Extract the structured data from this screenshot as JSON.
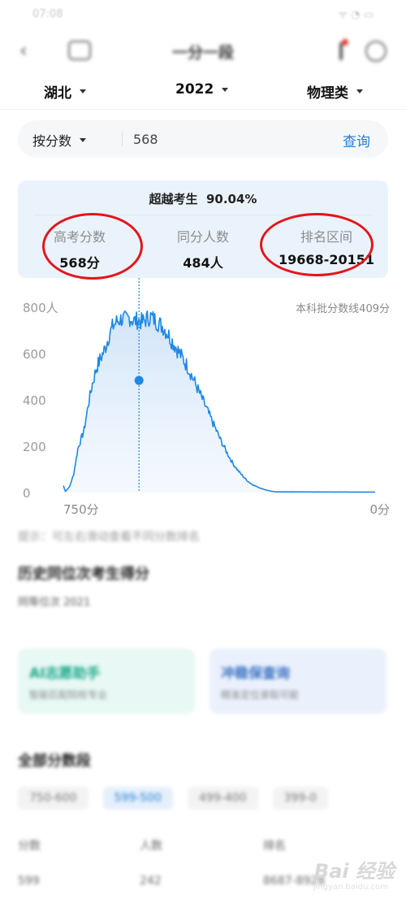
{
  "status_bar": {
    "time": "07:08",
    "right": "ᯤ ◔ ▭"
  },
  "nav": {
    "title": "一分一段"
  },
  "filters": {
    "province": "湖北",
    "year": "2022",
    "subject": "物理类"
  },
  "search": {
    "type": "按分数",
    "value": "568",
    "button": "查询"
  },
  "card": {
    "beat_label": "超越考生",
    "beat_value": "90.04%",
    "stats": [
      {
        "label": "高考分数",
        "value": "568分"
      },
      {
        "label": "同分人数",
        "value": "484人"
      },
      {
        "label": "排名区间",
        "value": "19668-20151"
      }
    ]
  },
  "chart_data": {
    "type": "area",
    "y_ticks": [
      "800人",
      "600",
      "400",
      "200",
      "0"
    ],
    "ylim": [
      0,
      800
    ],
    "x_left_label": "750分",
    "x_right_label": "0分",
    "xlim": [
      750,
      0
    ],
    "annotation": "本科批分数线409分",
    "marker": {
      "x": 568,
      "y": 484
    },
    "series": [
      {
        "color": "#1e88e5",
        "points": [
          [
            750,
            30
          ],
          [
            745,
            5
          ],
          [
            735,
            25
          ],
          [
            725,
            80
          ],
          [
            715,
            190
          ],
          [
            700,
            270
          ],
          [
            690,
            380
          ],
          [
            680,
            470
          ],
          [
            670,
            540
          ],
          [
            660,
            580
          ],
          [
            650,
            620
          ],
          [
            640,
            680
          ],
          [
            630,
            720
          ],
          [
            620,
            740
          ],
          [
            610,
            750
          ],
          [
            600,
            745
          ],
          [
            590,
            755
          ],
          [
            580,
            740
          ],
          [
            570,
            745
          ],
          [
            560,
            735
          ],
          [
            550,
            750
          ],
          [
            540,
            760
          ],
          [
            530,
            745
          ],
          [
            520,
            730
          ],
          [
            510,
            715
          ],
          [
            500,
            690
          ],
          [
            490,
            660
          ],
          [
            480,
            630
          ],
          [
            470,
            600
          ],
          [
            460,
            570
          ],
          [
            450,
            540
          ],
          [
            440,
            500
          ],
          [
            430,
            460
          ],
          [
            420,
            420
          ],
          [
            410,
            380
          ],
          [
            400,
            340
          ],
          [
            390,
            300
          ],
          [
            380,
            260
          ],
          [
            370,
            220
          ],
          [
            360,
            185
          ],
          [
            350,
            150
          ],
          [
            340,
            120
          ],
          [
            330,
            95
          ],
          [
            320,
            75
          ],
          [
            310,
            55
          ],
          [
            300,
            40
          ],
          [
            290,
            30
          ],
          [
            280,
            22
          ],
          [
            270,
            15
          ],
          [
            260,
            10
          ],
          [
            250,
            6
          ],
          [
            240,
            3
          ],
          [
            0,
            2
          ]
        ]
      }
    ],
    "grid": false
  },
  "footer": {
    "tip": "提示：可左右滑动查看不同分数排名",
    "history_title": "历史同位次考生得分",
    "history_sub": "同等位次 2021",
    "promo_left": {
      "title": "AI志愿助手",
      "sub": "智能匹配院校专业"
    },
    "promo_right": {
      "title": "冲稳保查询",
      "sub": "精准定位录取可能"
    },
    "table_title": "全部分数段",
    "chips": [
      "750-600",
      "599-500",
      "499-400",
      "399-0"
    ],
    "table": [
      {
        "c1": "分数",
        "c2": "人数",
        "c3": "排名"
      },
      {
        "c1": "599",
        "c2": "242",
        "c3": "8687-8928"
      }
    ]
  },
  "watermark": {
    "text": "Bai 经验",
    "sub": "jingyan.baidu.com"
  }
}
